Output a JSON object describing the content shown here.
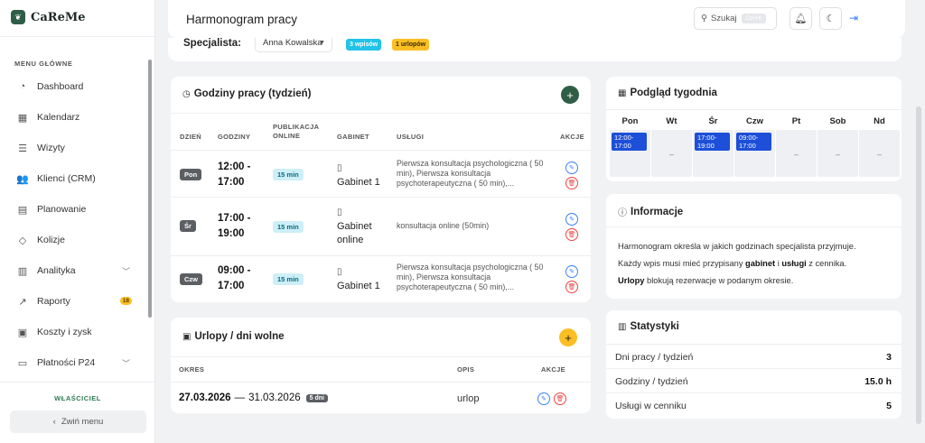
{
  "app": {
    "brand": "CaReMe",
    "logo_icon": "leaf-icon"
  },
  "sidebar": {
    "heading": "MENU GŁÓWNE",
    "items": [
      {
        "label": "Dashboard",
        "icon": "◔"
      },
      {
        "label": "Kalendarz",
        "icon": "▦"
      },
      {
        "label": "Wizyty",
        "icon": "☰"
      },
      {
        "label": "Klienci (CRM)",
        "icon": "👥"
      },
      {
        "label": "Planowanie",
        "icon": "▤"
      },
      {
        "label": "Kolizje",
        "icon": "◇"
      },
      {
        "label": "Analityka",
        "icon": "▥"
      },
      {
        "label": "Raporty",
        "icon": "↗",
        "badge": "18"
      },
      {
        "label": "Koszty i zysk",
        "icon": "▣"
      },
      {
        "label": "Płatności P24",
        "icon": "▭"
      }
    ],
    "role": "WŁAŚCICIEL",
    "collapse_label": "Zwiń menu"
  },
  "header": {
    "title": "Harmonogram pracy",
    "search_label": "Szukaj",
    "search_shortcut": "Ctrl+K"
  },
  "specialist": {
    "label": "Specjalista:",
    "selected": "Anna Kowalska",
    "entries_badge": "3 wpisów",
    "leaves_badge": "1 urlopów"
  },
  "hours": {
    "title": "Godziny pracy (tydzień)",
    "columns": [
      "DZIEŃ",
      "GODZINY",
      "PUBLIKACJA ONLINE",
      "GABINET",
      "USŁUGI",
      "AKCJE"
    ],
    "rows": [
      {
        "day": "Pon",
        "start": "12:00 -",
        "end": "17:00",
        "publication": "15 min",
        "room_line1": "Gabinet 1",
        "room_line2": "",
        "services": "Pierwsza konsultacja psychologiczna ( 50 min), Pierwsza konsultacja psychoterapeutyczna ( 50 min),..."
      },
      {
        "day": "Śr",
        "start": "17:00 -",
        "end": "19:00",
        "publication": "15 min",
        "room_line1": "Gabinet",
        "room_line2": "online",
        "services": "konsultacja online (50min)"
      },
      {
        "day": "Czw",
        "start": "09:00 -",
        "end": "17:00",
        "publication": "15 min",
        "room_line1": "Gabinet 1",
        "room_line2": "",
        "services": "Pierwsza konsultacja psychologiczna ( 50 min), Pierwsza konsultacja psychoterapeutyczna ( 50 min),..."
      }
    ]
  },
  "leaves": {
    "title": "Urlopy / dni wolne",
    "columns": [
      "OKRES",
      "OPIS",
      "AKCJE"
    ],
    "rows": [
      {
        "start": "27.03.2026",
        "separator": "—",
        "end": "31.03.2026",
        "days": "5 dni",
        "description": "urlop"
      }
    ]
  },
  "week": {
    "title": "Podgląd tygodnia",
    "days": [
      {
        "name": "Pon",
        "slot_start": "12:00-",
        "slot_end": "17:00"
      },
      {
        "name": "Wt",
        "slot_start": "",
        "slot_end": ""
      },
      {
        "name": "Śr",
        "slot_start": "17:00-",
        "slot_end": "19:00"
      },
      {
        "name": "Czw",
        "slot_start": "09:00-",
        "slot_end": "17:00"
      },
      {
        "name": "Pt",
        "slot_start": "",
        "slot_end": ""
      },
      {
        "name": "Sob",
        "slot_start": "",
        "slot_end": ""
      },
      {
        "name": "Nd",
        "slot_start": "",
        "slot_end": ""
      }
    ],
    "empty_marker": "–"
  },
  "info": {
    "title": "Informacje",
    "line1": "Harmonogram określa w jakich godzinach specjalista przyjmuje.",
    "line2_a": "Każdy wpis musi mieć przypisany ",
    "line2_b": "gabinet",
    "line2_c": " i ",
    "line2_d": "usługi",
    "line2_e": " z cennika.",
    "line3_a": "Urlopy",
    "line3_b": " blokują rezerwacje w podanym okresie."
  },
  "stats": {
    "title": "Statystyki",
    "rows": [
      {
        "label": "Dni pracy / tydzień",
        "value": "3"
      },
      {
        "label": "Godziny / tydzień",
        "value": "15.0 h"
      },
      {
        "label": "Usługi w cenniku",
        "value": "5"
      }
    ]
  },
  "colors": {
    "brand": "#2f5e47",
    "accent_blue": "#1d4fd8",
    "warning": "#fbbf24",
    "danger": "#ef4444"
  }
}
